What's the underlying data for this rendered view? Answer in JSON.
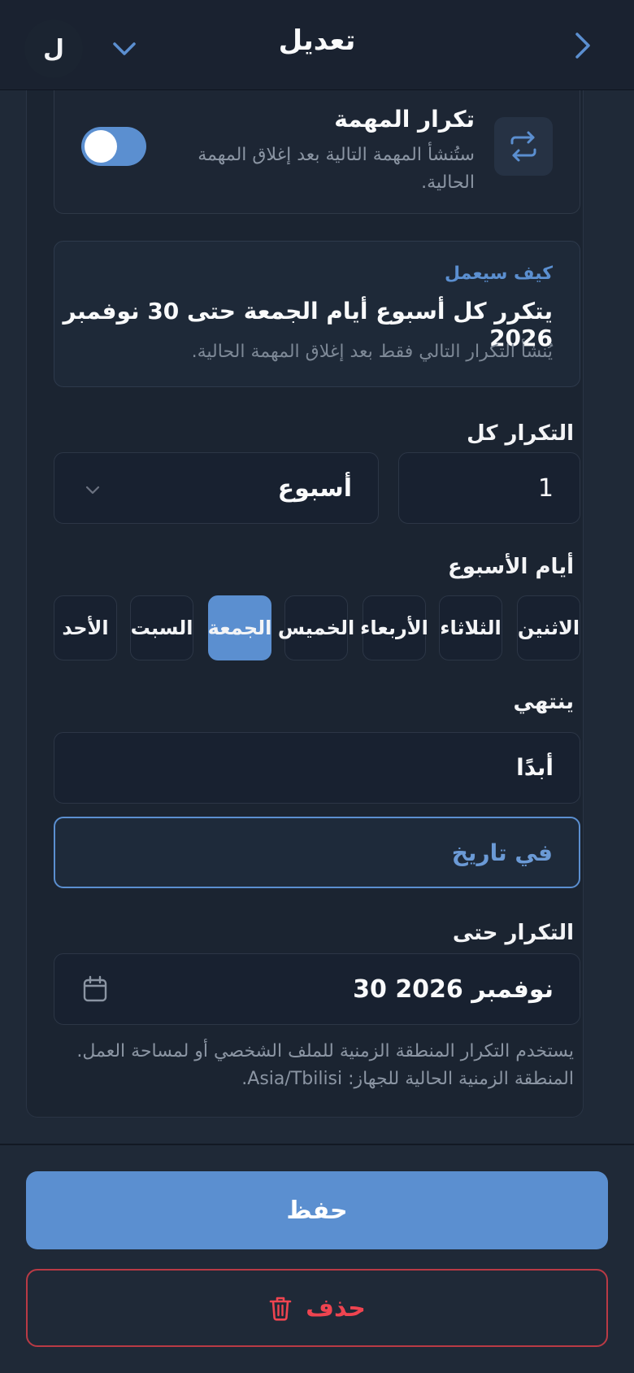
{
  "header": {
    "title": "تعديل",
    "avatar_letter": "ل"
  },
  "repeat": {
    "title": "تكرار المهمة",
    "subtitle": "ستُنشأ المهمة التالية بعد إغلاق المهمة الحالية.",
    "enabled": true
  },
  "how_it_works": {
    "label": "كيف سيعمل",
    "summary": "يتكرر كل أسبوع أيام الجمعة حتى 30 نوفمبر 2026",
    "note": "يُنشأ التكرار التالي فقط بعد إغلاق المهمة الحالية."
  },
  "interval": {
    "label": "التكرار كل",
    "value": "1",
    "unit": "أسبوع"
  },
  "weekdays": {
    "label": "أيام الأسبوع",
    "days": [
      "الاثنين",
      "الثلاثاء",
      "الأربعاء",
      "الخميس",
      "الجمعة",
      "السبت",
      "الأحد"
    ],
    "selected": "الجمعة"
  },
  "ends": {
    "label": "ينتهي",
    "never": "أبدًا",
    "on_date": "في تاريخ"
  },
  "until": {
    "label": "التكرار حتى",
    "value": "30 نوفمبر 2026"
  },
  "timezone_note": "يستخدم التكرار المنطقة الزمنية للملف الشخصي أو لمساحة العمل. المنطقة الزمنية الحالية للجهاز: Asia/Tbilisi.",
  "actions": {
    "save": "حفظ",
    "delete": "حذف"
  },
  "colors": {
    "accent": "#5b8fd0",
    "danger": "#ef4450",
    "background": "#1f2937"
  }
}
